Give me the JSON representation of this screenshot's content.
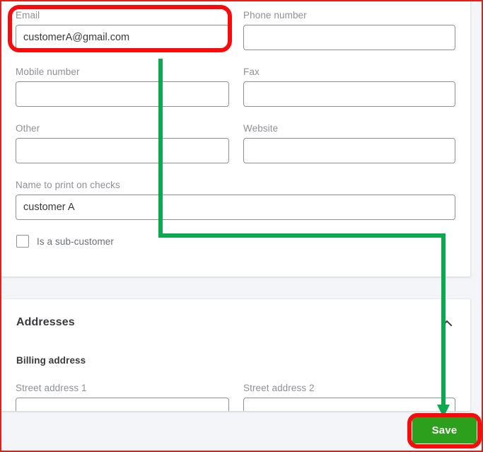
{
  "form": {
    "fields": [
      {
        "id": "email",
        "label": "Email",
        "value": "customerA@gmail.com",
        "placeholder": ""
      },
      {
        "id": "phone_number",
        "label": "Phone number",
        "value": "",
        "placeholder": ""
      },
      {
        "id": "mobile_number",
        "label": "Mobile number",
        "value": "",
        "placeholder": ""
      },
      {
        "id": "fax",
        "label": "Fax",
        "value": "",
        "placeholder": ""
      },
      {
        "id": "other",
        "label": "Other",
        "value": "",
        "placeholder": ""
      },
      {
        "id": "website",
        "label": "Website",
        "value": "",
        "placeholder": ""
      },
      {
        "id": "print_on_checks",
        "label": "Name to print on checks",
        "value": "customer A",
        "placeholder": ""
      }
    ],
    "sub_customer": {
      "label": "Is a sub-customer",
      "checked": false
    }
  },
  "addresses": {
    "title": "Addresses",
    "collapse_icon": "chevron-up-icon",
    "billing_title": "Billing address",
    "street_fields": [
      {
        "id": "street_address_1",
        "label": "Street address 1",
        "value": ""
      },
      {
        "id": "street_address_2",
        "label": "Street address 2",
        "value": ""
      }
    ]
  },
  "footer": {
    "save_label": "Save"
  },
  "annotations": {
    "highlight_color": "#fa0a0a",
    "arrow_color": "#0ba94e",
    "border_color": "#e0201b",
    "highlighted_elements": [
      "email-field",
      "save-button"
    ],
    "arrow_description": "green arrow from email field area to Save button"
  }
}
